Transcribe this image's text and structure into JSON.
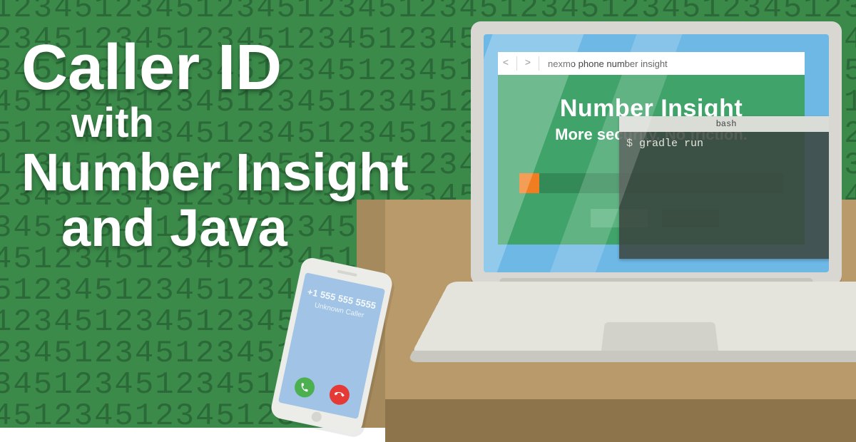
{
  "background_pattern": "12345",
  "headline": {
    "line1": "Caller ID",
    "line2": "with",
    "line3": "Number Insight",
    "line4": "and Java"
  },
  "browser": {
    "nav_back": "<",
    "nav_fwd": ">",
    "url": "nexmo phone number insight",
    "hero_title": "Number Insight",
    "hero_sub": "More security. No friction."
  },
  "terminal": {
    "title": "bash",
    "prompt": "$",
    "command": "gradle run"
  },
  "phone": {
    "number": "+1 555 555 5555",
    "label": "Unknown Caller"
  }
}
